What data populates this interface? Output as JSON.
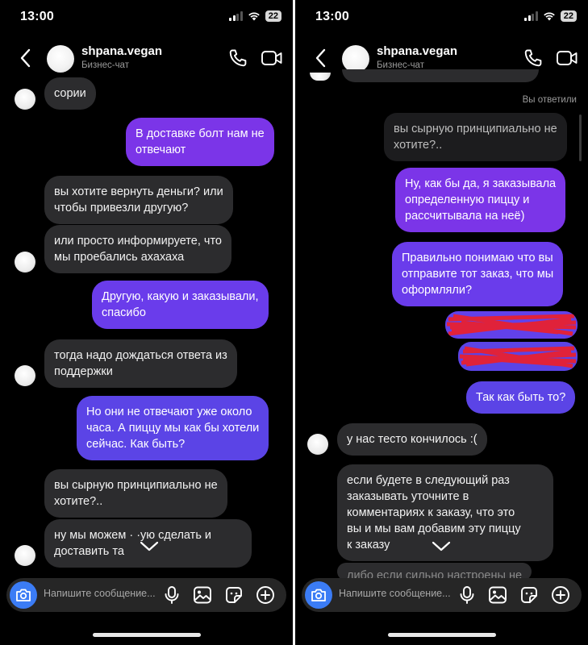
{
  "status": {
    "time": "13:00",
    "battery": "22"
  },
  "header": {
    "name": "shpana.vegan",
    "subtitle": "Бизнес-чат"
  },
  "composer": {
    "placeholder": "Напишите сообщение..."
  },
  "left": {
    "m1": "сории",
    "m2": [
      "В доставке болт нам не",
      "отвечают"
    ],
    "m3": [
      "вы хотите вернуть деньги? или",
      "чтобы привезли другую?"
    ],
    "m4": [
      "или просто информируете, что",
      "мы проебались ахахаха"
    ],
    "m5": [
      "Другую, какую и заказывали,",
      "спасибо"
    ],
    "m6": [
      "тогда надо дождаться ответа из",
      "поддержки"
    ],
    "m7": [
      "Но они не отвечают уже около",
      "часа. А пиццу мы как бы хотели",
      "сейчас. Как быть?"
    ],
    "m8": [
      "вы сырную принципиально не",
      "хотите?.."
    ],
    "m9": [
      "ну мы можем ·  ·ую сделать и",
      "доставить та"
    ]
  },
  "right": {
    "replied_label": "Вы ответили",
    "quoted": [
      "вы сырную принципиально не",
      "хотите?.."
    ],
    "r1": [
      "Ну, как бы да, я заказывала",
      "определенную пиццу и",
      "рассчитывала на неё)"
    ],
    "r2": [
      "Правильно понимаю что вы",
      "отправите тот заказ, что мы",
      "оформляли?"
    ],
    "r3": "Так как быть то?",
    "r4": "у нас тесто кончилось :(",
    "r5": [
      "если будете в следующий раз",
      "заказывать уточните в",
      "комментариях к заказу, что это",
      "вы и мы вам добавим эту пиццу",
      "к заказу"
    ],
    "r6": "либо если сильно настроены не"
  },
  "colors": {
    "incoming": "#2c2c2e",
    "outgoing_purple": "#7b35e8",
    "outgoing_blue": "#5b44e6",
    "camera_button": "#3b7cf5",
    "redaction": "#e0223a"
  }
}
